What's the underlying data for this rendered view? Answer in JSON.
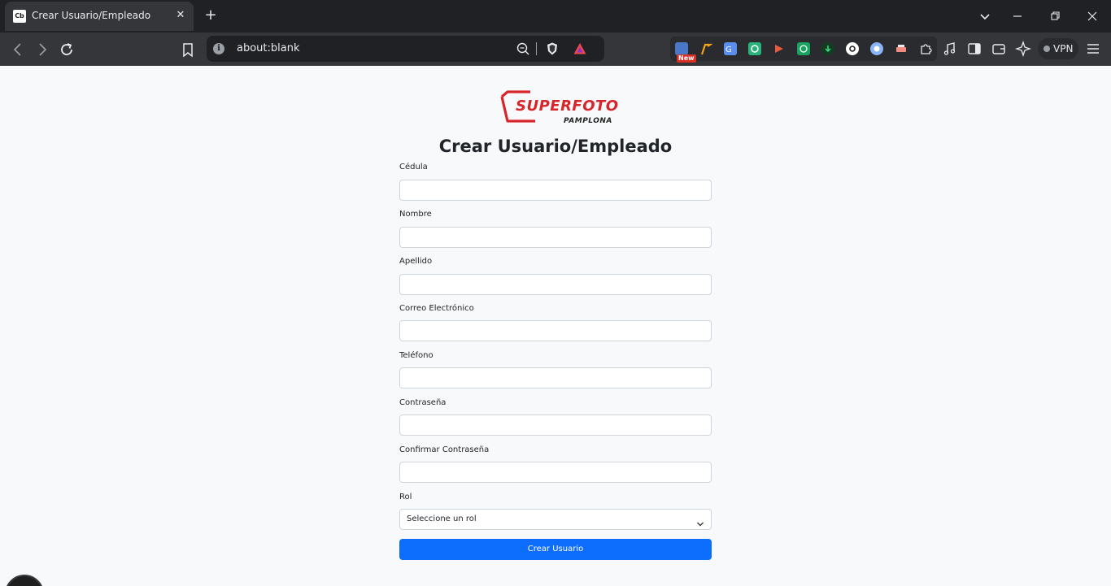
{
  "browser": {
    "tab": {
      "favicon_text": "Cb",
      "title": "Crear Usuario/Empleado"
    },
    "url": "about:blank",
    "vpn_label": "VPN",
    "extension_badge": "New"
  },
  "page": {
    "logo": {
      "main": "SUPERFOTO",
      "sub": "PAMPLONA"
    },
    "title": "Crear Usuario/Empleado",
    "fields": [
      {
        "label": "Cédula",
        "value": ""
      },
      {
        "label": "Nombre",
        "value": ""
      },
      {
        "label": "Apellido",
        "value": ""
      },
      {
        "label": "Correo Electrónico",
        "value": ""
      },
      {
        "label": "Teléfono",
        "value": ""
      },
      {
        "label": "Contraseña",
        "value": ""
      },
      {
        "label": "Confirmar Contraseña",
        "value": ""
      }
    ],
    "rol": {
      "label": "Rol",
      "selected": "Seleccione un rol"
    },
    "submit_label": "Crear Usuario",
    "colors": {
      "primary_button": "#0d6efd",
      "logo_red": "#d7262b",
      "page_bg": "#f8f9fa"
    }
  }
}
